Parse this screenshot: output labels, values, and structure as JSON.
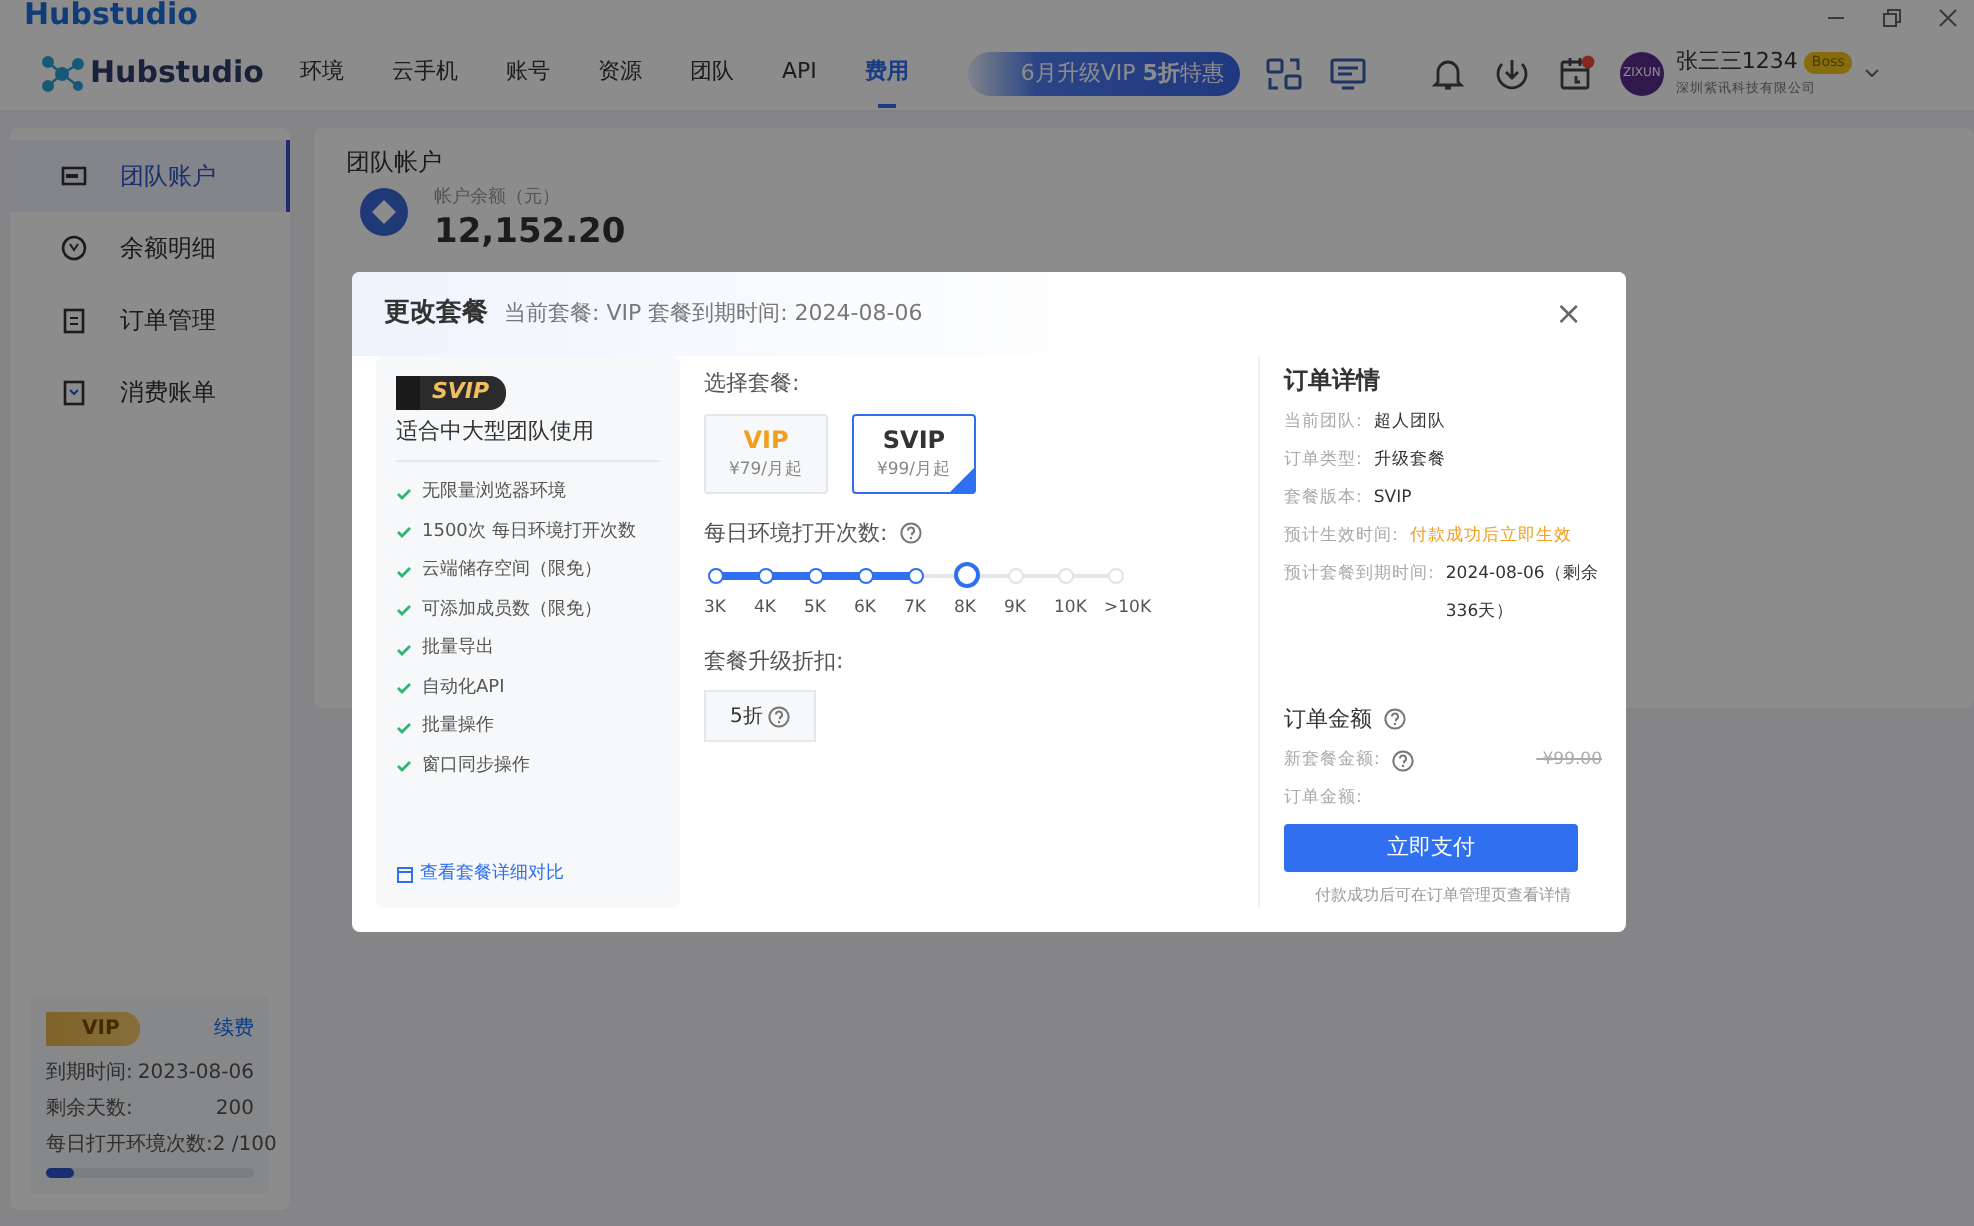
{
  "titlebar": {
    "app_name": "Hubstudio"
  },
  "nav": {
    "brand": "Hubstudio",
    "items": [
      {
        "label": "环境",
        "selected": false
      },
      {
        "label": "云手机",
        "selected": false
      },
      {
        "label": "账号",
        "selected": false
      },
      {
        "label": "资源",
        "selected": false
      },
      {
        "label": "团队",
        "selected": false
      },
      {
        "label": "API",
        "selected": false
      },
      {
        "label": "费用",
        "selected": true
      }
    ],
    "promo": "6月升级VIP **5折**特惠",
    "notification_dot": true,
    "user": {
      "avatar": "ZIXUN",
      "name": "张三三1234",
      "badge": "Boss",
      "company": "深圳紫讯科技有限公司"
    }
  },
  "sidebar": {
    "items": [
      {
        "label": "团队账户",
        "selected": true
      },
      {
        "label": "余额明细",
        "selected": false
      },
      {
        "label": "订单管理",
        "selected": false
      },
      {
        "label": "消费账单",
        "selected": false
      }
    ],
    "vip_card": {
      "tier": "VIP",
      "action": "续费",
      "rows": [
        {
          "label": "到期时间:",
          "value": "2023-08-06"
        },
        {
          "label": "剩余天数:",
          "value": "200"
        },
        {
          "label": "每日打开环境次数:",
          "value": "2 /100"
        }
      ],
      "level": 0.13
    }
  },
  "main": {
    "title": "团队帐户",
    "balance_label": "帐户余额（元）",
    "balance": "12,152.20"
  },
  "dialog": {
    "title": "更改套餐",
    "subtitle": "当前套餐: VIP 套餐到期时间: 2024-08-06",
    "close": "×",
    "plan_card": {
      "tier": "SVIP",
      "tagline": "适合中大型团队使用",
      "features": [
        "无限量浏览器环境",
        "1500次 每日环境打开次数",
        "云端储存空间（限免）",
        "可添加成员数（限免）",
        "批量导出",
        "自动化API",
        "批量操作",
        "窗口同步操作"
      ],
      "link": "查看套餐详细对比"
    },
    "plan_label": "选择套餐:",
    "plans": [
      {
        "name": "VIP",
        "price": "¥79/月起",
        "selected": false
      },
      {
        "name": "SVIP",
        "price": "¥99/月起",
        "selected": true
      }
    ],
    "opens_label": "每日环境打开次数:",
    "slider": {
      "level": 0.5,
      "stops": [
        {
          "label": "3K",
          "selected": false
        },
        {
          "label": "4K",
          "selected": false
        },
        {
          "label": "5K",
          "selected": false
        },
        {
          "label": "6K",
          "selected": false
        },
        {
          "label": "7K",
          "selected": false
        },
        {
          "label": "8K",
          "selected": true
        },
        {
          "label": "9K",
          "selected": false
        },
        {
          "label": "10K",
          "selected": false
        },
        {
          "label": ">10K",
          "selected": false
        }
      ]
    },
    "discount_label": "套餐升级折扣:",
    "discount": "5折",
    "order": {
      "title": "订单详情",
      "rows": [
        {
          "label": "当前团队:",
          "value": "超人团队",
          "kind": "plain"
        },
        {
          "label": "订单类型:",
          "value": "升级套餐",
          "kind": "plain"
        },
        {
          "label": "套餐版本:",
          "value": "SVIP",
          "kind": "plain"
        },
        {
          "label": "预计生效时间:",
          "value": "付款成功后立即生效",
          "kind": "highlight"
        },
        {
          "label": "预计套餐到期时间:",
          "value": "2024-08-06（剩余336天）",
          "kind": "plain"
        }
      ],
      "amount_title": "订单金额",
      "new_amount_label": "新套餐金额:",
      "new_amount": "-¥99.00",
      "total_label": "订单金额:",
      "pay": "立即支付",
      "note": "付款成功后可在订单管理页查看详情"
    }
  }
}
